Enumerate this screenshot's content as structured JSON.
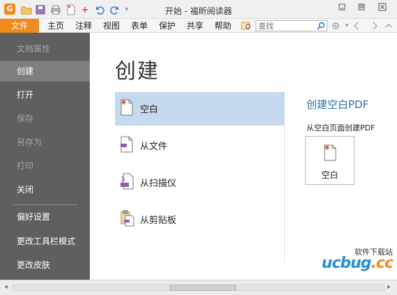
{
  "window": {
    "title": "开始 - 福昕阅读器",
    "logo_letter": "G",
    "quick_access": [
      "open-folder-icon",
      "save-icon",
      "print-icon",
      "new-doc-icon",
      "undo-icon",
      "redo-icon",
      "customize-dropdown-icon"
    ],
    "controls": [
      "minimize-icon",
      "restore-icon",
      "close-icon"
    ]
  },
  "menu": {
    "file_label": "文件",
    "items": [
      "主页",
      "注释",
      "视图",
      "表单",
      "保护",
      "共享",
      "帮助"
    ],
    "search_placeholder": "查找"
  },
  "sidebar": {
    "items": [
      {
        "label": "文档属性",
        "state": "disabled"
      },
      {
        "label": "创建",
        "state": "active"
      },
      {
        "label": "打开",
        "state": "normal"
      },
      {
        "label": "保存",
        "state": "disabled"
      },
      {
        "label": "另存为",
        "state": "disabled"
      },
      {
        "label": "打印",
        "state": "disabled"
      },
      {
        "label": "关闭",
        "state": "normal"
      },
      {
        "label": "偏好设置",
        "state": "normal"
      },
      {
        "label": "更改工具栏模式",
        "state": "normal"
      },
      {
        "label": "更改皮肤",
        "state": "normal"
      }
    ]
  },
  "main": {
    "title": "创建",
    "options": [
      {
        "label": "空白",
        "icon": "blank-doc-icon",
        "selected": true
      },
      {
        "label": "从文件",
        "icon": "from-file-icon",
        "selected": false
      },
      {
        "label": "从扫描仪",
        "icon": "scanner-icon",
        "selected": false
      },
      {
        "label": "从剪贴板",
        "icon": "clipboard-icon",
        "selected": false
      }
    ],
    "detail": {
      "title": "创建空白PDF",
      "subtitle": "从空白页面创建PDF",
      "tile_label": "空白"
    }
  },
  "watermark": {
    "top_text": "软件下载站",
    "brand_left": "ucbug",
    "brand_right": ".cc"
  },
  "colors": {
    "accent_orange": "#f08c1e",
    "sidebar_bg": "#5f5f5f",
    "sidebar_active": "#7e7e7e",
    "selection_blue": "#c6d9ef",
    "heading_blue": "#2e6da4"
  }
}
